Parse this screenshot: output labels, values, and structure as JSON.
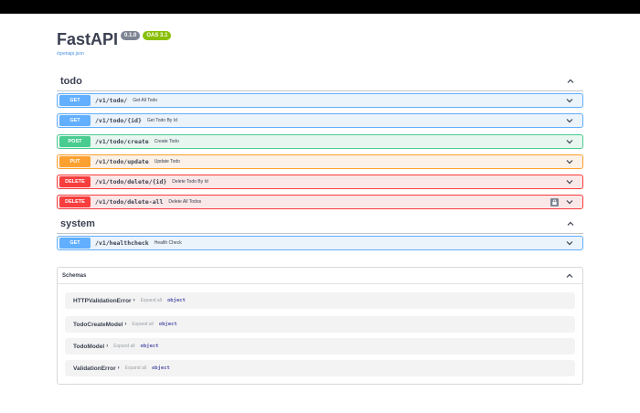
{
  "info": {
    "title": "FastAPI",
    "version": "0.1.0",
    "oas": "OAS 3.1",
    "spec_link": "/openapi.json"
  },
  "sections": [
    {
      "name": "todo",
      "operations": [
        {
          "method": "GET",
          "path": "/v1/todo/",
          "summary": "Get All Todo",
          "locked": false
        },
        {
          "method": "GET",
          "path": "/v1/todo/{id}",
          "summary": "Get Todo By Id",
          "locked": false
        },
        {
          "method": "POST",
          "path": "/v1/todo/create",
          "summary": "Create Todo",
          "locked": false
        },
        {
          "method": "PUT",
          "path": "/v1/todo/update",
          "summary": "Update Todo",
          "locked": false
        },
        {
          "method": "DELETE",
          "path": "/v1/todo/delete/{id}",
          "summary": "Delete Todo By Id",
          "locked": false
        },
        {
          "method": "DELETE",
          "path": "/v1/todo/delete-all",
          "summary": "Delete All Todos",
          "locked": true
        }
      ]
    },
    {
      "name": "system",
      "operations": [
        {
          "method": "GET",
          "path": "/v1/healthcheck",
          "summary": "Health Check",
          "locked": false
        }
      ]
    }
  ],
  "schemas": {
    "title": "Schemas",
    "models": [
      {
        "name": "HTTPValidationError",
        "expand": "Expand all",
        "type": "object"
      },
      {
        "name": "TodoCreateModel",
        "expand": "Expand all",
        "type": "object"
      },
      {
        "name": "TodoModel",
        "expand": "Expand all",
        "type": "object"
      },
      {
        "name": "ValidationError",
        "expand": "Expand all",
        "type": "object"
      }
    ]
  },
  "colors": {
    "get": "#61affe",
    "post": "#49cc90",
    "put": "#fca130",
    "delete": "#f93e3e",
    "version_badge": "#7d8492",
    "oas_badge": "#89bf04"
  },
  "icons": {
    "section_toggle": "chevron-up-icon",
    "operation_toggle": "chevron-down-icon",
    "auth": "lock-icon",
    "model_expand": "chevron-right-icon"
  }
}
